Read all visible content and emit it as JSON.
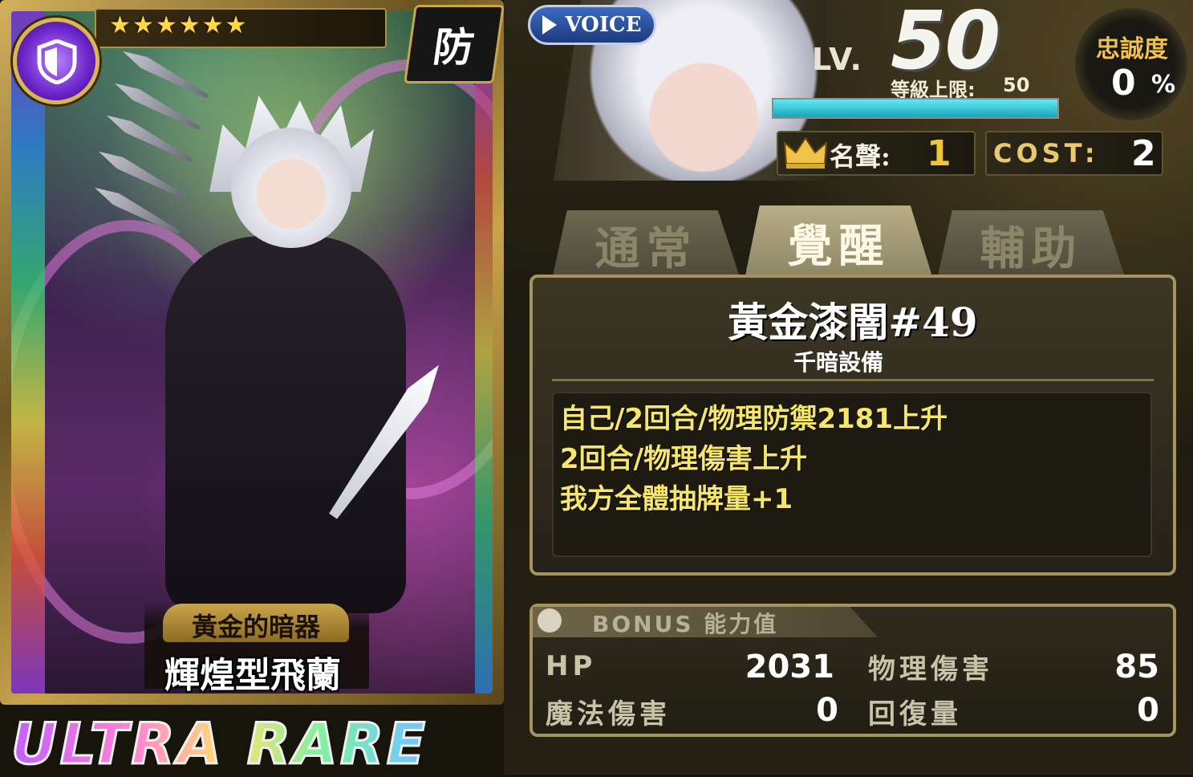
{
  "card": {
    "rarity_stars": "★★★★★★",
    "role": "防",
    "subtitle": "黃金的暗器",
    "name": "輝煌型飛蘭",
    "rarity": "ULTRA RARE",
    "type_icon": "shield-icon",
    "star_count": 6
  },
  "status": {
    "voice_label": "VOICE",
    "level_label": "LV.",
    "level": "50",
    "level_cap_label": "等級上限:",
    "level_cap": "50",
    "exp_progress": 1.0,
    "loyalty_label": "忠誠度",
    "loyalty_value": "0",
    "loyalty_unit": "%",
    "fame_label": "名聲:",
    "fame_value": "1",
    "cost_label": "COST:",
    "cost_value": "2"
  },
  "tabs": [
    {
      "label": "通常",
      "active": false
    },
    {
      "label": "覺醒",
      "active": true
    },
    {
      "label": "輔助",
      "active": false
    }
  ],
  "skill": {
    "name": "黃金漆闇#49",
    "type": "千暗設備",
    "lines": [
      "自己/2回合/物理防禦2181上升",
      "2回合/物理傷害上升",
      "我方全體抽牌量+1"
    ]
  },
  "bonus": {
    "title": "BONUS 能力值",
    "stats": [
      {
        "label": "HP",
        "value": "2031"
      },
      {
        "label": "物理傷害",
        "value": "85"
      },
      {
        "label": "魔法傷害",
        "value": "0"
      },
      {
        "label": "回復量",
        "value": "0"
      }
    ]
  },
  "colors": {
    "gold": "#a59360",
    "skill_text": "#f6e66a",
    "fame_value": "#f3c53c",
    "exp_bar": "#1aa5bd"
  }
}
